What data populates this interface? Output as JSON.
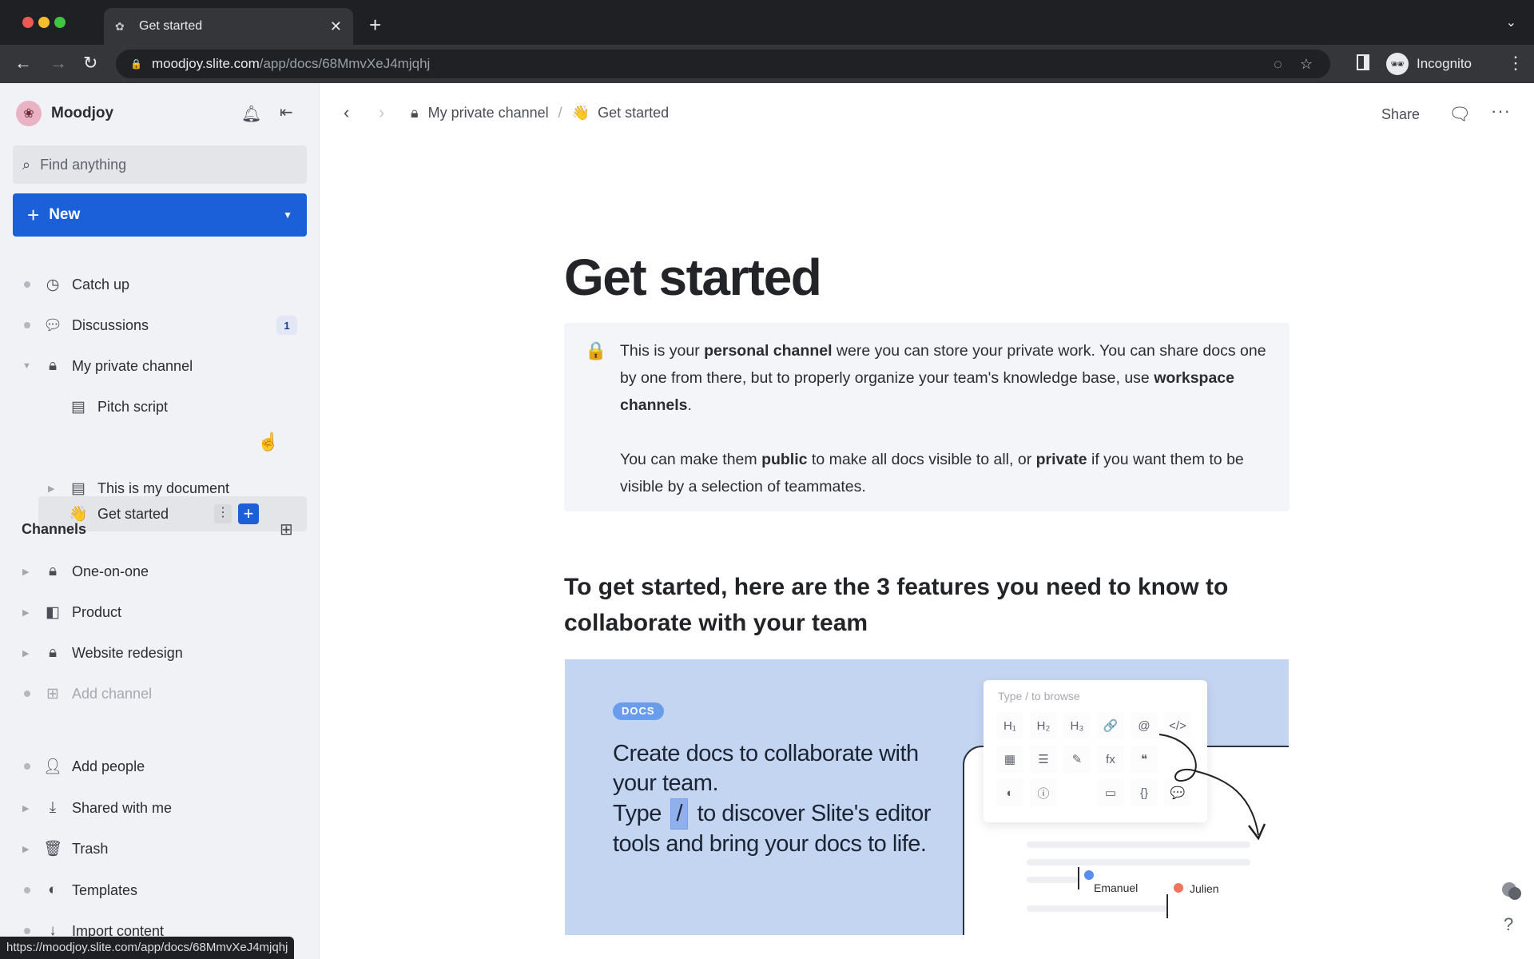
{
  "browser": {
    "tab_title": "Get started",
    "url_host": "moodjoy.slite.com",
    "url_path": "/app/docs/68MmvXeJ4mjqhj",
    "profile_label": "Incognito",
    "status_url": "https://moodjoy.slite.com/app/docs/68MmvXeJ4mjqhj"
  },
  "sidebar": {
    "workspace_name": "Moodjoy",
    "search_placeholder": "Find anything",
    "new_label": "New",
    "items": [
      {
        "label": "Catch up",
        "icon": "clock-icon"
      },
      {
        "label": "Discussions",
        "icon": "discussions-icon",
        "badge": "1"
      },
      {
        "label": "My private channel",
        "icon": "lock-icon",
        "expanded": true
      },
      {
        "label": "Pitch script",
        "icon": "doc-icon"
      },
      {
        "label": "Get started",
        "icon": "👋",
        "selected": true
      },
      {
        "label": "This is my document",
        "icon": "doc-icon"
      }
    ],
    "channels_title": "Channels",
    "channels": [
      {
        "label": "One-on-one",
        "icon": "lock-icon"
      },
      {
        "label": "Product",
        "icon": "channel-icon"
      },
      {
        "label": "Website redesign",
        "icon": "lock-icon"
      },
      {
        "label": "Add channel",
        "icon": "add-channel-icon",
        "muted": true
      }
    ],
    "bottom": [
      {
        "label": "Add people",
        "icon": "add-person-icon"
      },
      {
        "label": "Shared with me",
        "icon": "inbox-icon"
      },
      {
        "label": "Trash",
        "icon": "trash-icon"
      },
      {
        "label": "Templates",
        "icon": "templates-icon"
      },
      {
        "label": "Import content",
        "icon": "import-icon"
      }
    ]
  },
  "header": {
    "breadcrumb_channel": "My private channel",
    "breadcrumb_sep": "/",
    "breadcrumb_doc_emoji": "👋",
    "breadcrumb_doc": "Get started",
    "share_label": "Share"
  },
  "doc": {
    "title": "Get started",
    "callout_emoji": "🔒",
    "callout_p1": [
      {
        "t": "This is your "
      },
      {
        "t": "personal channel",
        "b": true
      },
      {
        "t": " were you can store your private work.  You can share docs one by one from there, but to properly organize your team's knowledge base, use "
      },
      {
        "t": "workspace channels",
        "b": true
      },
      {
        "t": "."
      }
    ],
    "callout_p2": [
      {
        "t": "You can make them "
      },
      {
        "t": "public",
        "b": true
      },
      {
        "t": " to make all docs visible to all, or "
      },
      {
        "t": "private",
        "b": true
      },
      {
        "t": " if you want them to be visible by a selection of teammates."
      }
    ],
    "heading": "To get started, here are the 3 features you need to know to collaborate with your team",
    "banner": {
      "tag": "DOCS",
      "line1": "Create docs to collaborate with your team.",
      "line2_before": "Type",
      "slash": "/",
      "line2_after": "to discover Slite's editor tools and bring your docs to life.",
      "palette_placeholder": "Type / to browse",
      "palette_items": [
        "H₁",
        "H₂",
        "H₃",
        "🔗",
        "@",
        "</>",
        "▦",
        "☰",
        "✎",
        "fx",
        "❝",
        "",
        "◐",
        "ⓘ",
        "",
        "▭",
        "{}",
        "💬"
      ],
      "cursor_user_1": "Emanuel",
      "cursor_user_2": "Julien",
      "cursor_color_1": "#5b8def",
      "cursor_color_2": "#f07560"
    }
  },
  "help": {
    "label": "?"
  }
}
